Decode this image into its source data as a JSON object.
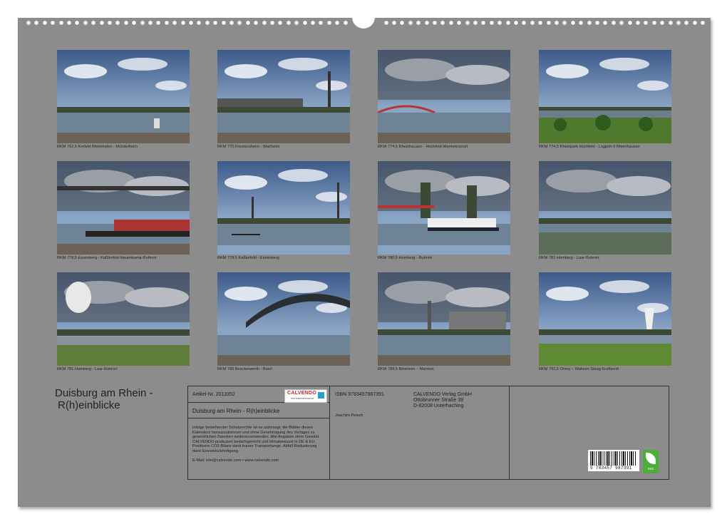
{
  "calendar": {
    "title_line1": "Duisburg am Rhein  -",
    "title_line2": "R(h)einblicke"
  },
  "photos": [
    {
      "caption": "RKM 762,5 Krefeld Rheinhafen - Mündelheim",
      "scene": "river-clouds"
    },
    {
      "caption": "RKM 770 Friemersheim - Wanheim",
      "scene": "river-chimney"
    },
    {
      "caption": "RKM 774,5 Rheinhausen - Hochfeld-Wanheimerort",
      "scene": "river-bridge-far"
    },
    {
      "caption": "RKM 774,5 Rheinpark Hochfeld - Logport II Rheinhausen",
      "scene": "park-trees"
    },
    {
      "caption": "RKM 778,5 Essenberg - Kaßlerfeld-Neuenkamp-Ruhrort",
      "scene": "ship-bridge"
    },
    {
      "caption": "RKM 778,5 Kaßlerfeld - Essenberg",
      "scene": "rowing"
    },
    {
      "caption": "RKM 780,5 Homberg - Ruhrort",
      "scene": "ship-towers"
    },
    {
      "caption": "RKM 781 Homberg - Laar-Ruhrort",
      "scene": "cloudy-river"
    },
    {
      "caption": "RKM 781 Homberg - Laar-Ruhrort",
      "scene": "steam-field"
    },
    {
      "caption": "RKM 785 Beeckerwerth - Baerl",
      "scene": "arch-bridge"
    },
    {
      "caption": "RKM 788,5 Binsheim – Marxloh",
      "scene": "industry-river"
    },
    {
      "caption": "RKM 792,5 Orsoy – Walsum Steag-Kraftwerk",
      "scene": "power-plant"
    }
  ],
  "info": {
    "article_label": "Artikel-Nr. 2013352",
    "product_title": "Duisburg am Rhein  -  R(h)einblicke",
    "legal_text": "Infolge bestehender Schutzrechte ist es untersagt, die Blätter dieses Kalenders herauszutrennen und ohne Genehmigung des Verlages zu gewerblichen Zwecken weiterzuverwenden. Alle Angaben ohne Gewähr. CALVENDO produziert bedarfsgerecht und klimabewusst in DE & EU. Positivere CO2-Bilanz dank kurzer Transportwege. Abfall-Reduzierung dank Einzelstückfertigung.",
    "contact": "E-Mail: info@calvendo.com • www.calvendo.com",
    "isbn": "ISBN 9783457987391",
    "author": "Joachim Petsch",
    "publisher_name": "CALVENDO Verlag GmbH",
    "publisher_street": "Ottobrunner Straße 39",
    "publisher_city": "D-82008 Unterhaching",
    "logo_text": "CALVENDO",
    "logo_sub": "Ihre Kalendermacher",
    "barcode_number": "9 783457 987391",
    "eco_label": "eco"
  }
}
